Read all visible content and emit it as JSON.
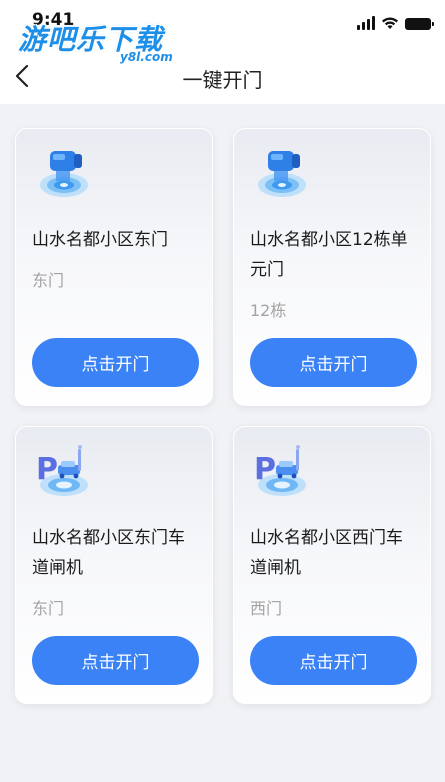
{
  "status_bar": {
    "time": "9:41"
  },
  "watermark": {
    "main": "游吧乐下载",
    "sub": "y8l.com"
  },
  "header": {
    "title": "一键开门"
  },
  "cards": [
    {
      "title": "山水名都小区东门",
      "subtitle": "东门",
      "button": "点击开门",
      "icon": "door-camera-icon"
    },
    {
      "title": "山水名都小区12栋单元门",
      "subtitle": "12栋",
      "button": "点击开门",
      "icon": "door-camera-icon"
    },
    {
      "title": "山水名都小区东门车道闸机",
      "subtitle": "东门",
      "button": "点击开门",
      "icon": "parking-gate-icon"
    },
    {
      "title": "山水名都小区西门车道闸机",
      "subtitle": "西门",
      "button": "点击开门",
      "icon": "parking-gate-icon"
    }
  ],
  "colors": {
    "accent": "#3a82f6",
    "background": "#f1f2f5"
  }
}
